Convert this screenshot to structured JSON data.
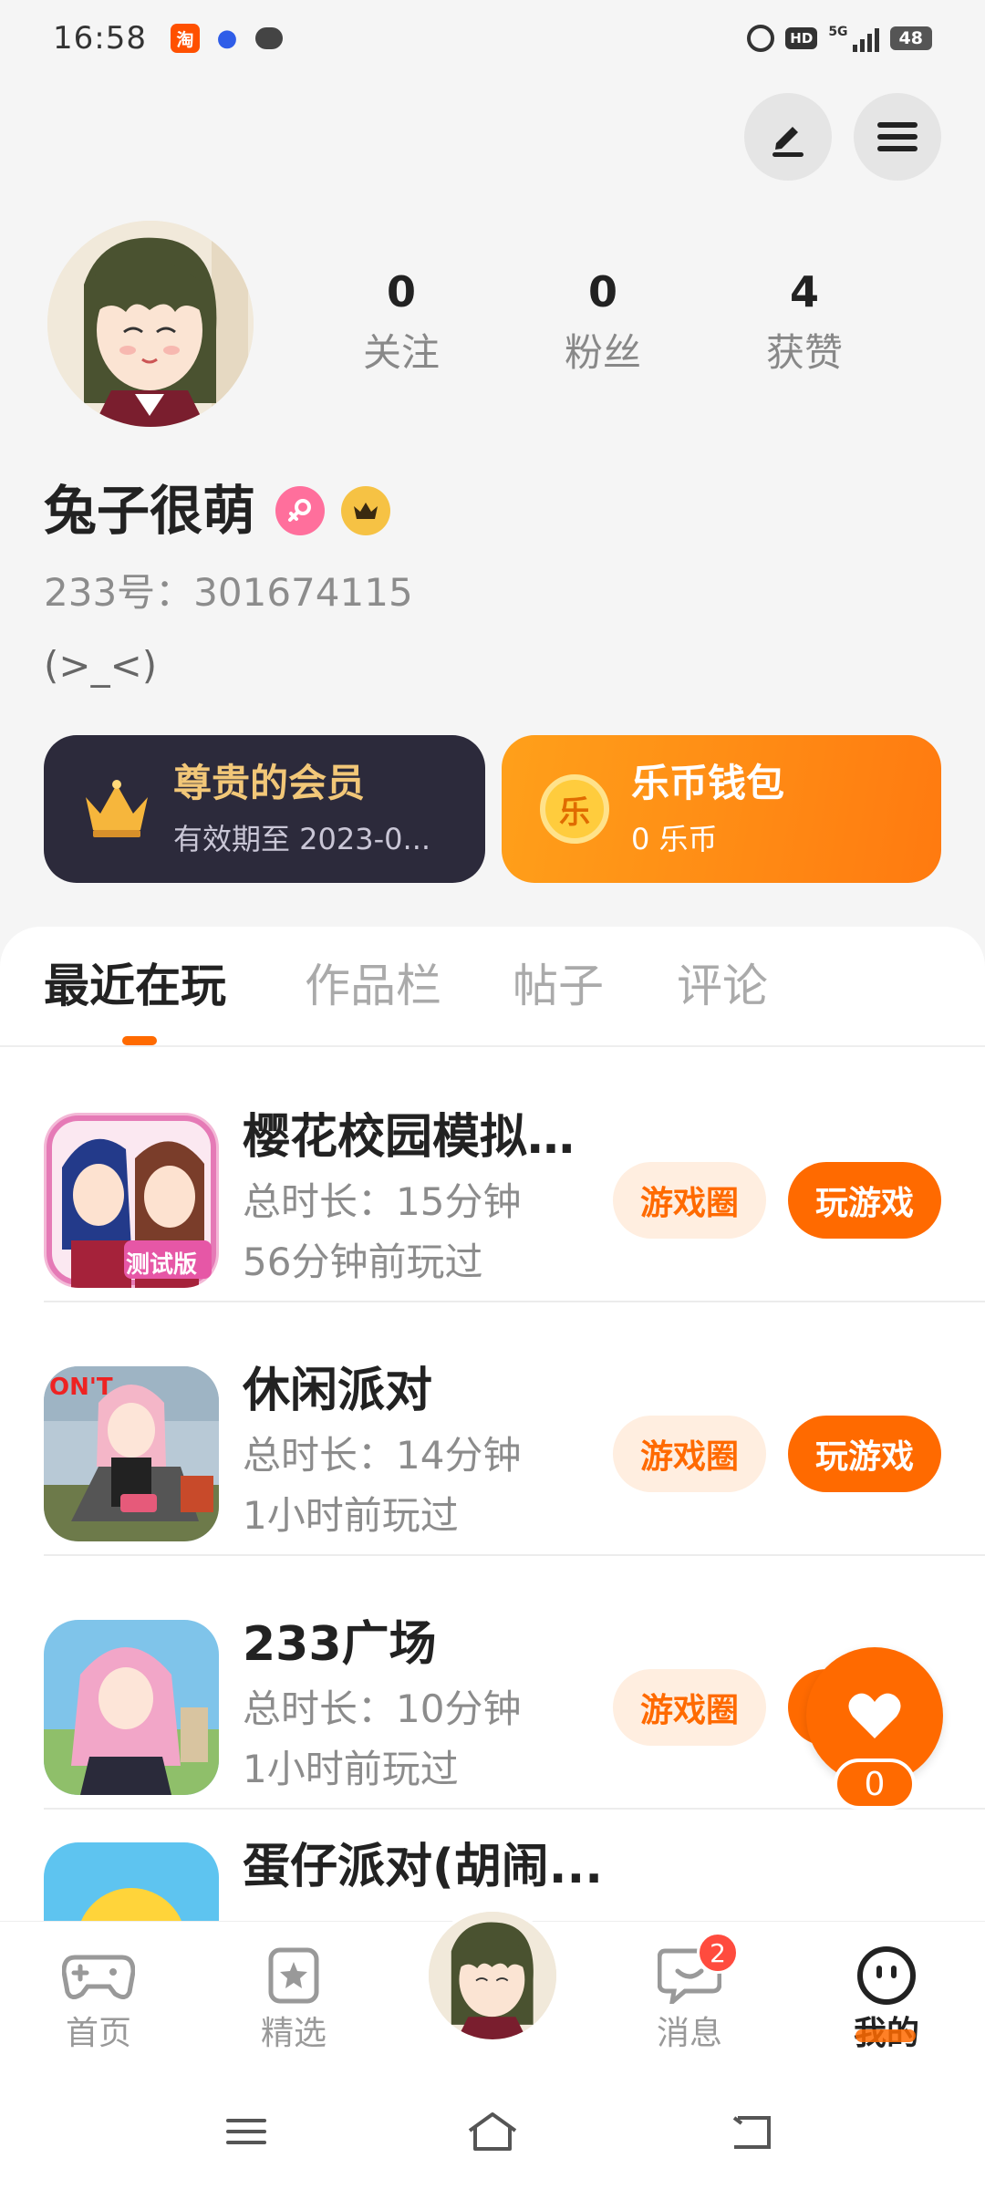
{
  "status_bar": {
    "time": "16:58",
    "hd": "HD",
    "net": "5G",
    "battery": "48"
  },
  "profile": {
    "stats": [
      {
        "value": "0",
        "label": "关注"
      },
      {
        "value": "0",
        "label": "粉丝"
      },
      {
        "value": "4",
        "label": "获赞"
      }
    ],
    "username": "兔子很萌",
    "id_text": "233号：301674115",
    "signature": "(>_<)"
  },
  "cards": {
    "vip": {
      "title": "尊贵的会员",
      "subtitle": "有效期至 2023-0..."
    },
    "wallet": {
      "title": "乐币钱包",
      "subtitle": "0 乐币",
      "coin_glyph": "乐"
    }
  },
  "tabs": [
    "最近在玩",
    "作品栏",
    "帖子",
    "评论"
  ],
  "games": [
    {
      "name": "樱花校园模拟...",
      "duration": "总时长：15分钟",
      "last_played": "56分钟前玩过",
      "circle_label": "游戏圈",
      "play_label": "玩游戏",
      "icon_text": "测试版"
    },
    {
      "name": "休闲派对",
      "duration": "总时长：14分钟",
      "last_played": "1小时前玩过",
      "circle_label": "游戏圈",
      "play_label": "玩游戏",
      "icon_text": "ON'T"
    },
    {
      "name": "233广场",
      "duration": "总时长：10分钟",
      "last_played": "1小时前玩过",
      "circle_label": "游戏圈",
      "play_label": "玩游戏",
      "icon_text": ""
    },
    {
      "name": "蛋仔派对(胡闹...",
      "duration": "",
      "last_played": "",
      "circle_label": "",
      "play_label": "",
      "icon_text": ""
    }
  ],
  "float_like": {
    "count": "0"
  },
  "bottom_nav": {
    "items": [
      {
        "label": "首页"
      },
      {
        "label": "精选"
      },
      {
        "label": "消息"
      },
      {
        "label": "我的"
      }
    ],
    "message_badge": "2"
  },
  "colors": {
    "accent": "#ff6a00",
    "vip_card": "#2c2a3b",
    "vip_text": "#f2c778"
  }
}
